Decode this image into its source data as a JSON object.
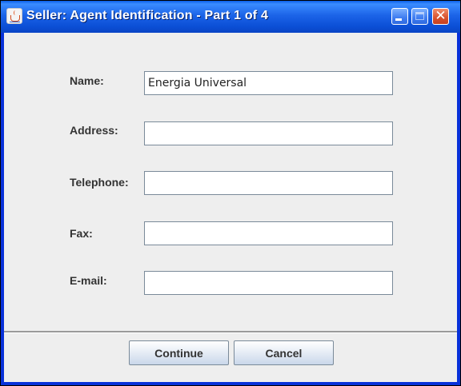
{
  "window": {
    "title": "Seller: Agent Identification - Part 1 of 4",
    "icon": "java-icon",
    "controls": {
      "minimize": "minimize-icon",
      "maximize": "maximize-icon",
      "close": "close-icon",
      "close_glyph": "✕"
    }
  },
  "form": {
    "fields": [
      {
        "label": "Name:",
        "value": "Energia Universal"
      },
      {
        "label": "Address:",
        "value": ""
      },
      {
        "label": "Telephone:",
        "value": ""
      },
      {
        "label": "Fax:",
        "value": ""
      },
      {
        "label": "E-mail:",
        "value": ""
      }
    ]
  },
  "buttons": {
    "continue_label": "Continue",
    "cancel_label": "Cancel"
  }
}
